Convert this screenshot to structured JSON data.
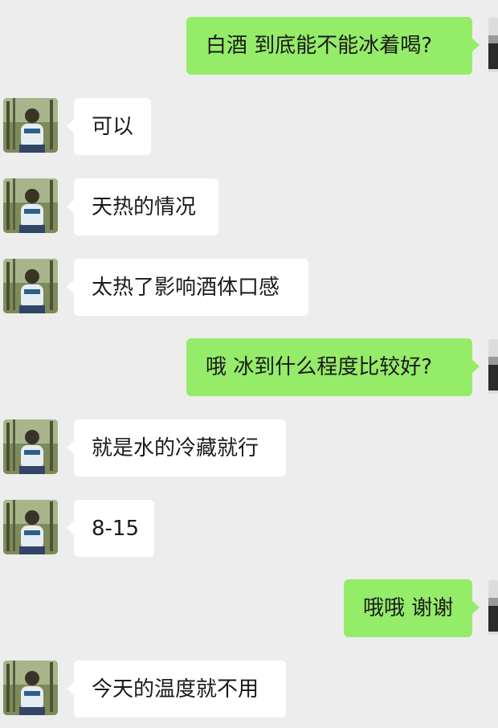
{
  "chat": {
    "messages": [
      {
        "side": "out",
        "text": "白酒 到底能不能冰着喝?"
      },
      {
        "side": "in",
        "text": "可以"
      },
      {
        "side": "in",
        "text": "天热的情况"
      },
      {
        "side": "in",
        "text": "太热了影响酒体口感"
      },
      {
        "side": "out",
        "text": "哦 冰到什么程度比较好?"
      },
      {
        "side": "in",
        "text": "就是水的冷藏就行"
      },
      {
        "side": "in",
        "text": "8-15"
      },
      {
        "side": "out",
        "text": "哦哦 谢谢"
      },
      {
        "side": "in",
        "text": "今天的温度就不用"
      }
    ]
  },
  "colors": {
    "background": "#ededed",
    "incoming_bubble": "#ffffff",
    "outgoing_bubble": "#95ec69",
    "text": "#1a1a1a"
  },
  "icons": {
    "contact_avatar": "contact-avatar-photo",
    "my_avatar": "my-avatar-photo"
  }
}
